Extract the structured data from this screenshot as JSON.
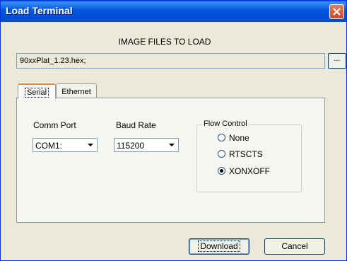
{
  "window": {
    "title": "Load Terminal"
  },
  "heading": "IMAGE FILES TO LOAD",
  "file_path": {
    "value": "90xxPlat_1.23.hex;"
  },
  "browse_label": "...",
  "tabs": [
    {
      "label": "Serial",
      "active": true
    },
    {
      "label": "Ethernet",
      "active": false
    }
  ],
  "serial": {
    "comm_port": {
      "label": "Comm Port",
      "value": "COM1:"
    },
    "baud_rate": {
      "label": "Baud Rate",
      "value": "115200"
    },
    "flow_control": {
      "label": "Flow Control",
      "options": [
        {
          "label": "None",
          "selected": false
        },
        {
          "label": "RTSCTS",
          "selected": false
        },
        {
          "label": "XONXOFF",
          "selected": true
        }
      ]
    }
  },
  "buttons": {
    "download": "Download",
    "cancel": "Cancel"
  },
  "colors": {
    "titlebar": "#0054e3",
    "close": "#d6562d",
    "tab_highlight": "#e68b2c"
  }
}
